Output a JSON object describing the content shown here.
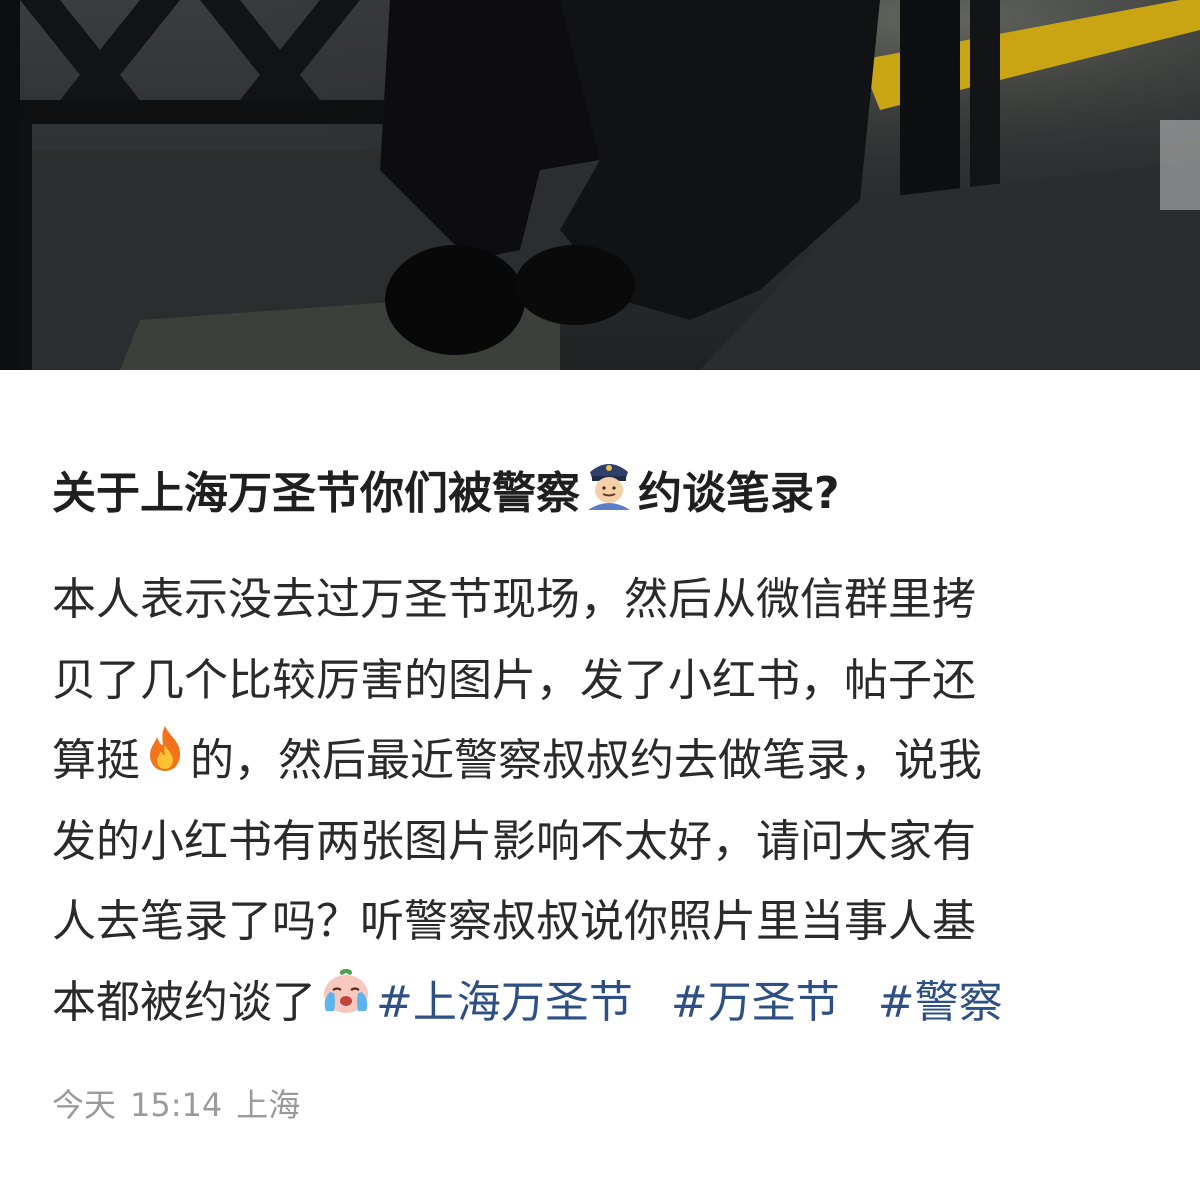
{
  "post": {
    "title_text": "关于上海万圣节你们被警察",
    "title_suffix": "约谈笔录?",
    "title_emoji": "police-officer-icon",
    "body_lines": {
      "l1": "本人表示没去过万圣节现场，然后从微信群里拷",
      "l2": "贝了几个比较厉害的图片，发了小红书，帖子还",
      "l3_a": "算挺",
      "l3_emoji": "fire-icon",
      "l3_b": "的，然后最近警察叔叔约去做笔录，说我",
      "l4": "发的小红书有两张图片影响不太好，请问大家有",
      "l5": "人去笔录了吗？听警察叔叔说你照片里当事人基",
      "l6_a": "本都被约谈了",
      "l6_emoji": "crying-face-icon"
    },
    "hashtags": [
      "#上海万圣节",
      "#万圣节",
      "#警察"
    ],
    "meta": {
      "date": "今天",
      "time": "15:14",
      "location": "上海"
    }
  },
  "colors": {
    "hashtag": "#2d4f84",
    "title": "#1f1f1f",
    "body": "#2a2a2a",
    "meta": "#9a9a9a"
  }
}
